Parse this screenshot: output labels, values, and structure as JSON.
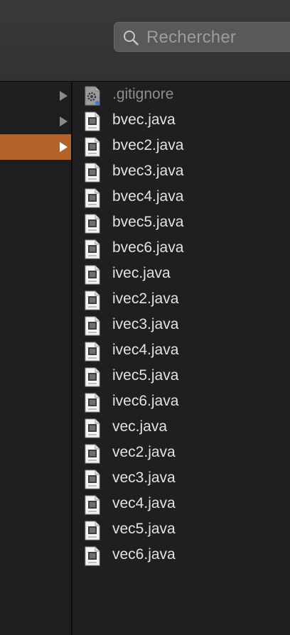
{
  "search": {
    "placeholder": "Rechercher"
  },
  "column1": {
    "rows": [
      {
        "selected": false
      },
      {
        "selected": false
      },
      {
        "selected": true
      }
    ]
  },
  "files": [
    {
      "name": ".gitignore",
      "icon": "gear-doc-icon",
      "dim": true
    },
    {
      "name": "bvec.java",
      "icon": "java-file-icon"
    },
    {
      "name": "bvec2.java",
      "icon": "java-file-icon"
    },
    {
      "name": "bvec3.java",
      "icon": "java-file-icon"
    },
    {
      "name": "bvec4.java",
      "icon": "java-file-icon"
    },
    {
      "name": "bvec5.java",
      "icon": "java-file-icon"
    },
    {
      "name": "bvec6.java",
      "icon": "java-file-icon"
    },
    {
      "name": "ivec.java",
      "icon": "java-file-icon"
    },
    {
      "name": "ivec2.java",
      "icon": "java-file-icon"
    },
    {
      "name": "ivec3.java",
      "icon": "java-file-icon"
    },
    {
      "name": "ivec4.java",
      "icon": "java-file-icon"
    },
    {
      "name": "ivec5.java",
      "icon": "java-file-icon"
    },
    {
      "name": "ivec6.java",
      "icon": "java-file-icon"
    },
    {
      "name": "vec.java",
      "icon": "java-file-icon"
    },
    {
      "name": "vec2.java",
      "icon": "java-file-icon"
    },
    {
      "name": "vec3.java",
      "icon": "java-file-icon"
    },
    {
      "name": "vec4.java",
      "icon": "java-file-icon"
    },
    {
      "name": "vec5.java",
      "icon": "java-file-icon"
    },
    {
      "name": "vec6.java",
      "icon": "java-file-icon"
    }
  ],
  "colors": {
    "selection": "#b3632a",
    "text": "#e2e2e4",
    "dim_text": "#8e8e90"
  }
}
